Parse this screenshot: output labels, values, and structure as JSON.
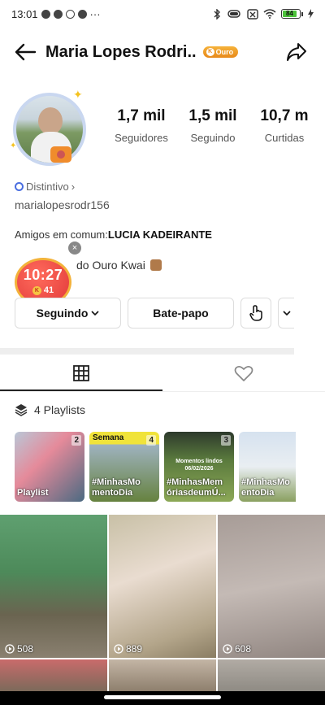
{
  "status_bar": {
    "time": "13:01",
    "dots": "···",
    "battery": "84"
  },
  "header": {
    "title": "Maria Lopes Rodri..",
    "badge": "Ouro"
  },
  "stats": [
    {
      "value": "1,7 mil",
      "label": "Seguidores"
    },
    {
      "value": "1,5 mil",
      "label": "Seguindo"
    },
    {
      "value": "10,7 m",
      "label": "Curtidas"
    }
  ],
  "profile": {
    "distintivo": "Distintivo",
    "username": "marialopesrodr156",
    "mutual_prefix": "Amigos em comum:",
    "mutual_name": "LUCIA KADEIRANTE",
    "ouro_text": "do Ouro Kwai"
  },
  "timer": {
    "time": "10:27",
    "coins": "41"
  },
  "actions": {
    "follow": "Seguindo",
    "chat": "Bate-papo"
  },
  "playlists": {
    "header": "4 Playlists",
    "items": [
      {
        "count": "2",
        "text": "Playlist",
        "top": "",
        "mid": ""
      },
      {
        "count": "4",
        "text": "#MinhasMo mentoDia",
        "top": "Semana",
        "mid": ""
      },
      {
        "count": "3",
        "text": "#MinhasMem óriasdeumÚ...",
        "top": "",
        "mid": "Momentos lindos 06/02/2026"
      },
      {
        "count": "",
        "text": "#MinhasMo entoDia",
        "top": "",
        "mid": ""
      }
    ]
  },
  "videos": [
    {
      "views": "508"
    },
    {
      "views": "889"
    },
    {
      "views": "608"
    }
  ]
}
